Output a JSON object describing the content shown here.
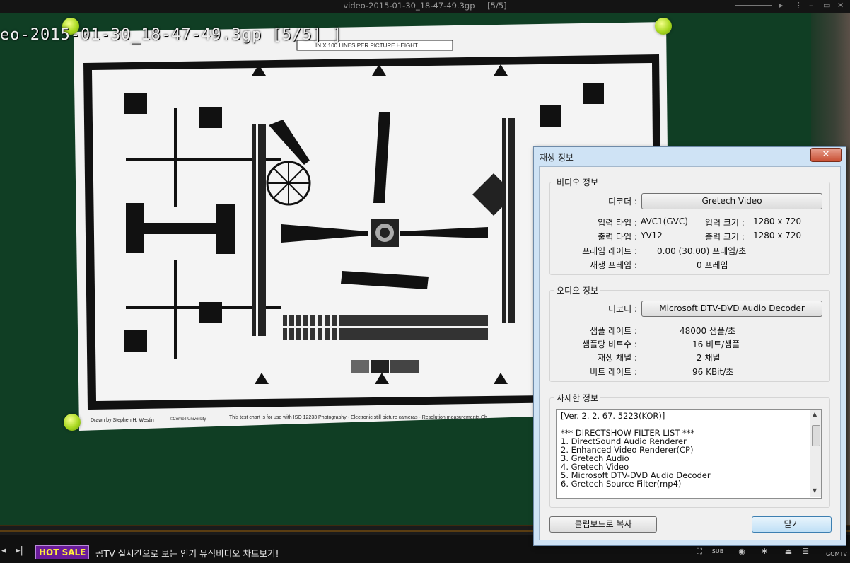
{
  "window": {
    "title": "video-2015-01-30_18-47-49.3gp",
    "playlist_pos": "[5/5]"
  },
  "osd": {
    "text": "eo-2015-01-30_18-47-49.3gp [5/5] ]"
  },
  "chart_footer": {
    "credit": "Drawn by Stephen H. Westin",
    "org": "©Cornell University",
    "note": "This test chart is for use with ISO 12233 Photography - Electronic still picture cameras - Resolution measurements Ch",
    "header": "IN X 100 LINES PER PICTURE HEIGHT"
  },
  "player": {
    "hot_sale": "HOT SALE",
    "promo": "곰TV 실시간으로 보는 인기 뮤직비디오 차트보기!",
    "sub_label": "SUB",
    "brand": "GOMTV"
  },
  "dialog": {
    "title": "재생 정보",
    "close": "✕",
    "video": {
      "group": "비디오 정보",
      "decoder_label": "디코더 :",
      "decoder_value": "Gretech Video",
      "input_type_label": "입력 타입 :",
      "input_type_value": "AVC1(GVC)",
      "input_size_label": "입력 크기 :",
      "input_size_value": "1280 x 720",
      "output_type_label": "출력 타입 :",
      "output_type_value": "YV12",
      "output_size_label": "출력 크기 :",
      "output_size_value": "1280 x 720",
      "frame_rate_label": "프레임 레이트 :",
      "frame_rate_value": "0.00 (30.00) 프레임/초",
      "played_frames_label": "재생 프레임 :",
      "played_frames_value": "0 프레임"
    },
    "audio": {
      "group": "오디오 정보",
      "decoder_label": "디코더 :",
      "decoder_value": "Microsoft DTV-DVD Audio Decoder",
      "sample_rate_label": "샘플 레이트 :",
      "sample_rate_value": "48000 샘플/초",
      "bits_label": "샘플당 비트수 :",
      "bits_value": "16 비트/샘플",
      "channels_label": "재생 채널 :",
      "channels_value": "2 채널",
      "bitrate_label": "비트 레이트 :",
      "bitrate_value": "96 KBit/초"
    },
    "details": {
      "group": "자세한 정보",
      "lines": [
        "[Ver. 2. 2. 67. 5223(KOR)]",
        "",
        "*** DIRECTSHOW FILTER LIST ***",
        "1. DirectSound Audio Renderer",
        "2. Enhanced Video Renderer(CP)",
        "3. Gretech Audio",
        "4. Gretech Video",
        "5. Microsoft DTV-DVD Audio Decoder",
        "6. Gretech Source Filter(mp4)"
      ]
    },
    "copy_button": "클립보드로 복사",
    "close_button": "닫기"
  }
}
